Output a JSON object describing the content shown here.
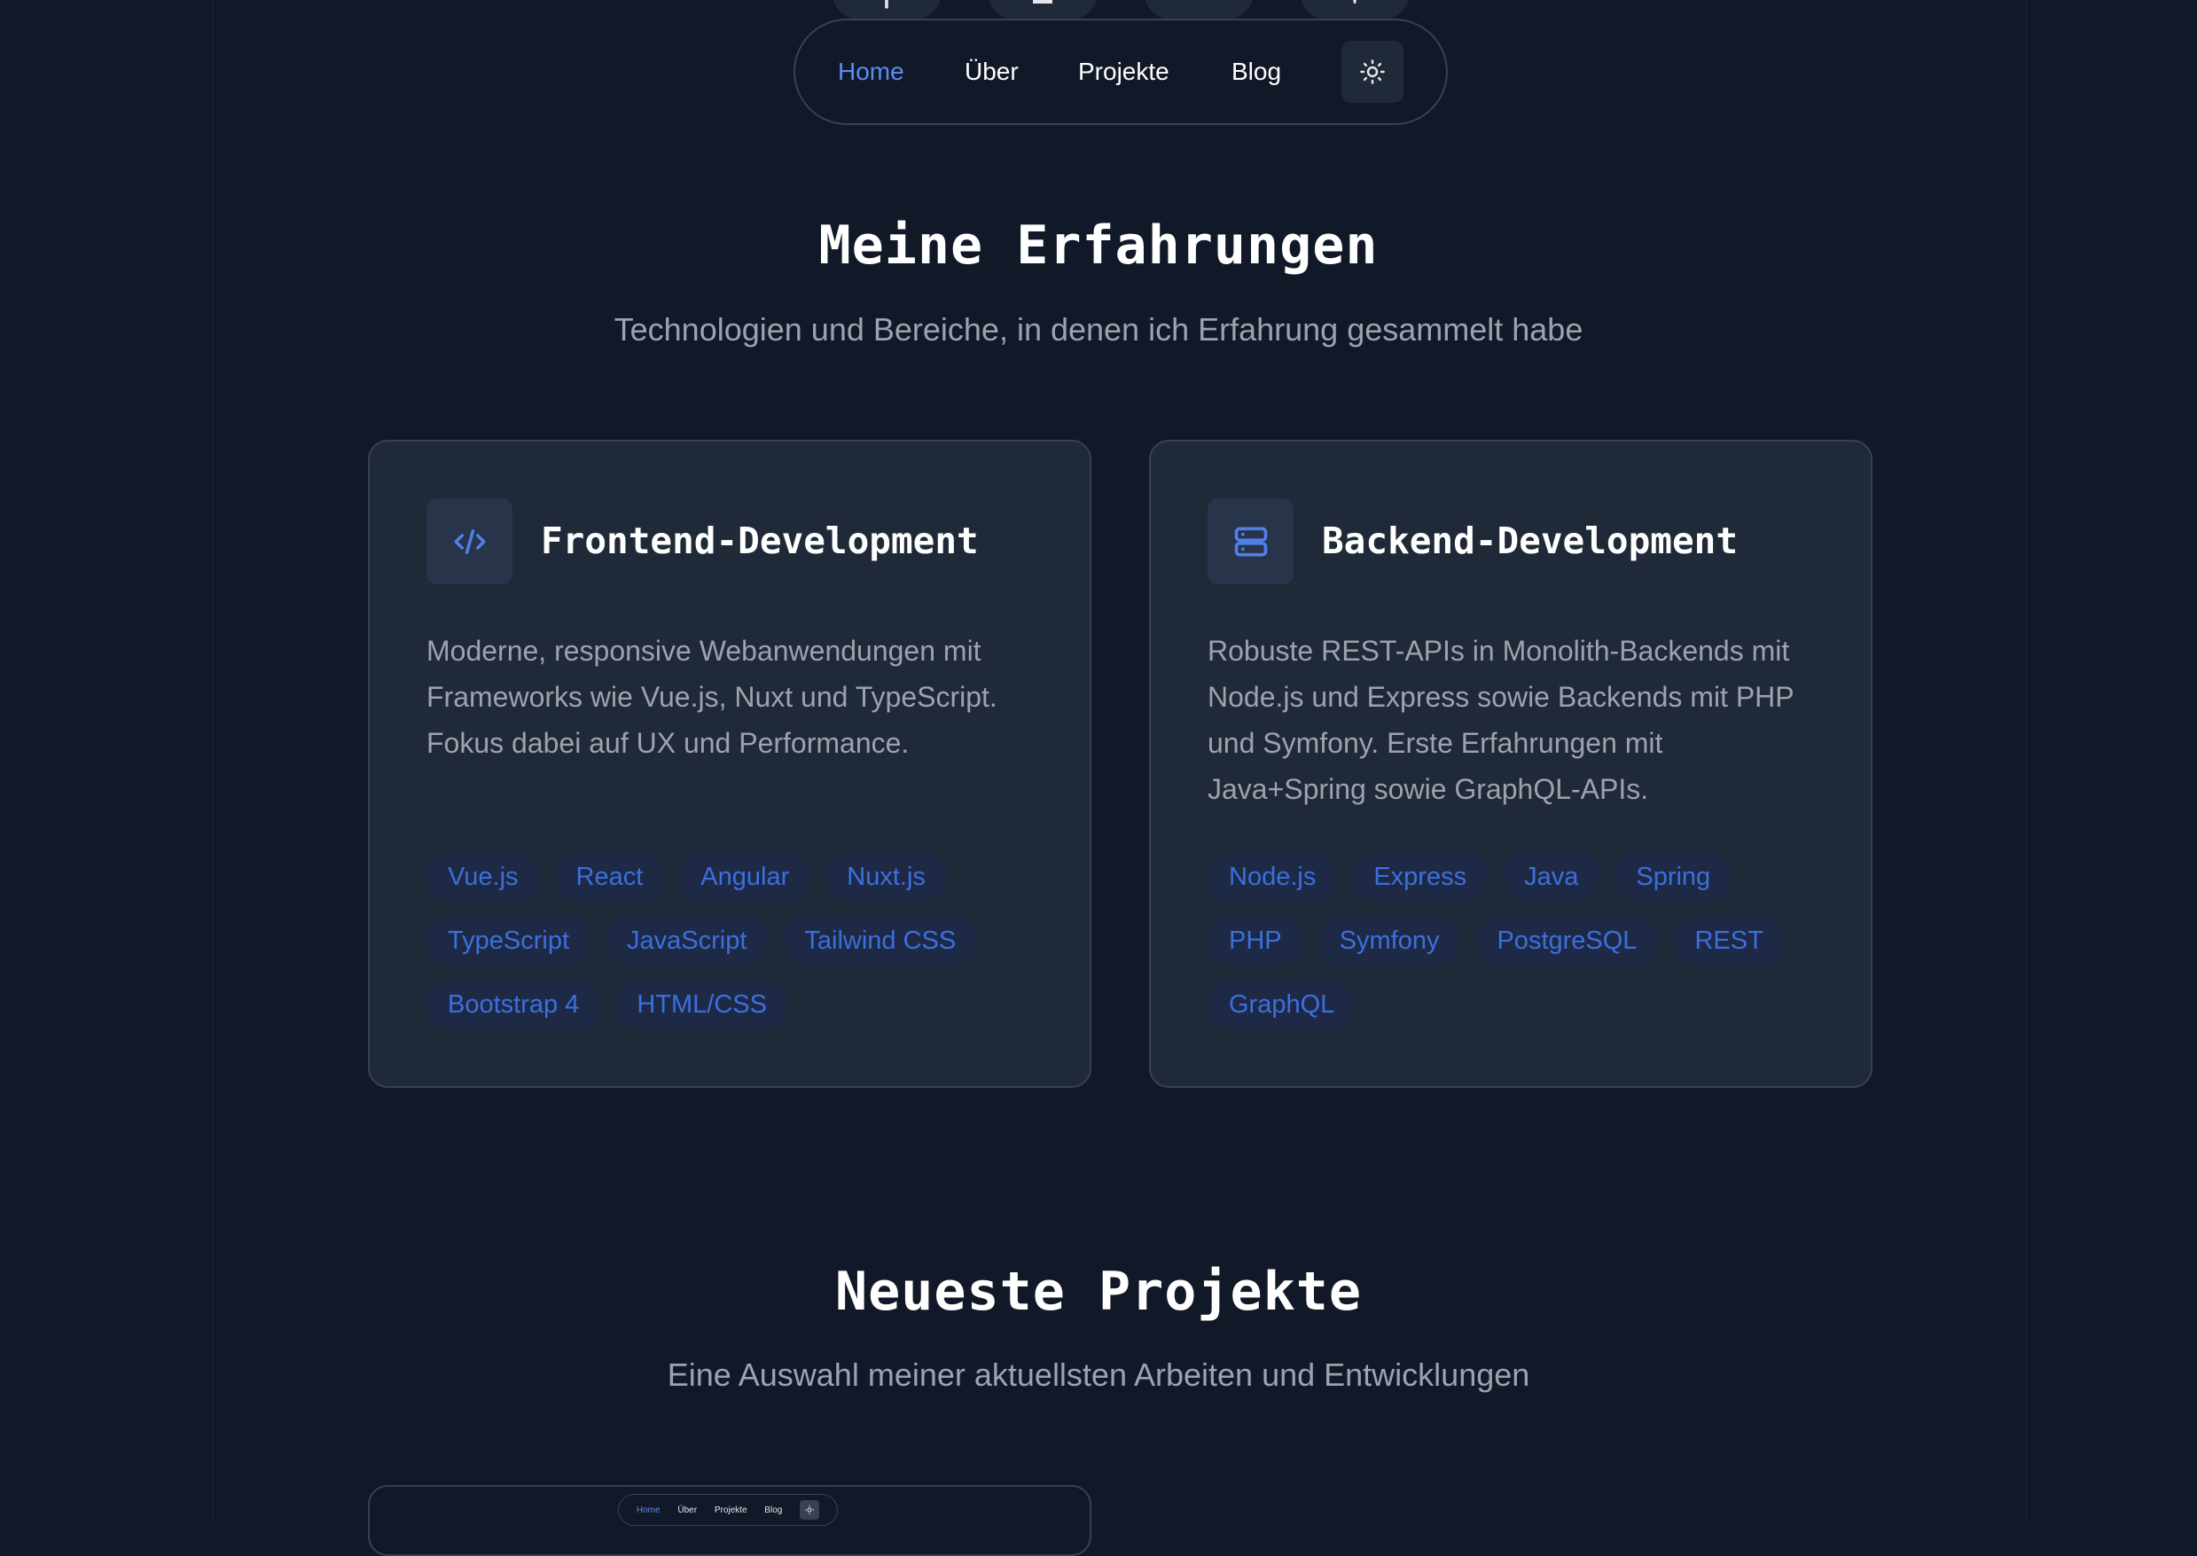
{
  "nav": {
    "items": [
      {
        "label": "Home",
        "active": true
      },
      {
        "label": "Über",
        "active": false
      },
      {
        "label": "Projekte",
        "active": false
      },
      {
        "label": "Blog",
        "active": false
      }
    ],
    "theme_toggle_icon": "sun-icon"
  },
  "experience": {
    "title": "Meine Erfahrungen",
    "subtitle": "Technologien und Bereiche, in denen ich Erfahrung gesammelt habe",
    "cards": [
      {
        "icon": "code-icon",
        "title": "Frontend-Development",
        "description": "Moderne, responsive Webanwendungen mit Frameworks wie Vue.js, Nuxt und TypeScript. Fokus dabei auf UX und Performance.",
        "tags": [
          "Vue.js",
          "React",
          "Angular",
          "Nuxt.js",
          "TypeScript",
          "JavaScript",
          "Tailwind CSS",
          "Bootstrap 4",
          "HTML/CSS"
        ]
      },
      {
        "icon": "server-icon",
        "title": "Backend-Development",
        "description": "Robuste REST-APIs in Monolith-Backends mit Node.js und Express sowie Backends mit PHP und Symfony. Erste Erfahrungen mit Java+Spring sowie GraphQL-APIs.",
        "tags": [
          "Node.js",
          "Express",
          "Java",
          "Spring",
          "PHP",
          "Symfony",
          "PostgreSQL",
          "REST",
          "GraphQL"
        ]
      }
    ]
  },
  "projects": {
    "title": "Neueste Projekte",
    "subtitle": "Eine Auswahl meiner aktuellsten Arbeiten und Entwicklungen",
    "preview_nav": [
      "Home",
      "Über",
      "Projekte",
      "Blog"
    ]
  },
  "colors": {
    "background": "#111827",
    "card": "#1f2937",
    "accent": "#5b8def",
    "tag_text": "#3b6fe0",
    "muted_text": "#9ca3af"
  }
}
